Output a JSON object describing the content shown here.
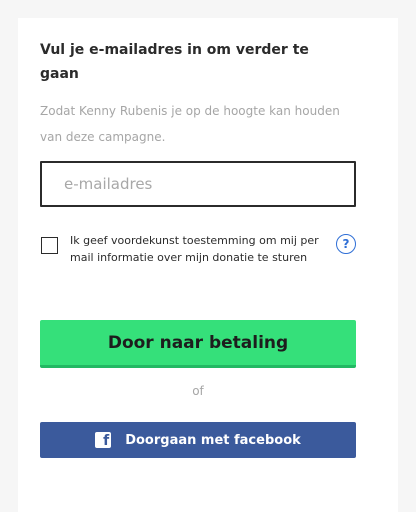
{
  "form": {
    "heading": "Vul je e-mailadres in om verder te gaan",
    "subtext": "Zodat Kenny Rubenis je op de hoogte kan houden van deze campagne.",
    "email_placeholder": "e-mailadres",
    "email_value": "",
    "consent_text": "Ik geef voordekunst toestemming om mij per mail informatie over mijn donatie te sturen",
    "consent_checked": false,
    "help_glyph": "?",
    "pay_button_label": "Door naar betaling",
    "or_text": "of",
    "facebook_icon_glyph": "f",
    "facebook_button_label": "Doorgaan met facebook"
  },
  "icons": {
    "help": "question-circle-icon",
    "facebook": "facebook-logo-icon"
  },
  "colors": {
    "pay_button": "#35e07a",
    "facebook_button": "#3b5a9c",
    "help_icon": "#2f6fd6",
    "muted_text": "#a6a6a6"
  }
}
